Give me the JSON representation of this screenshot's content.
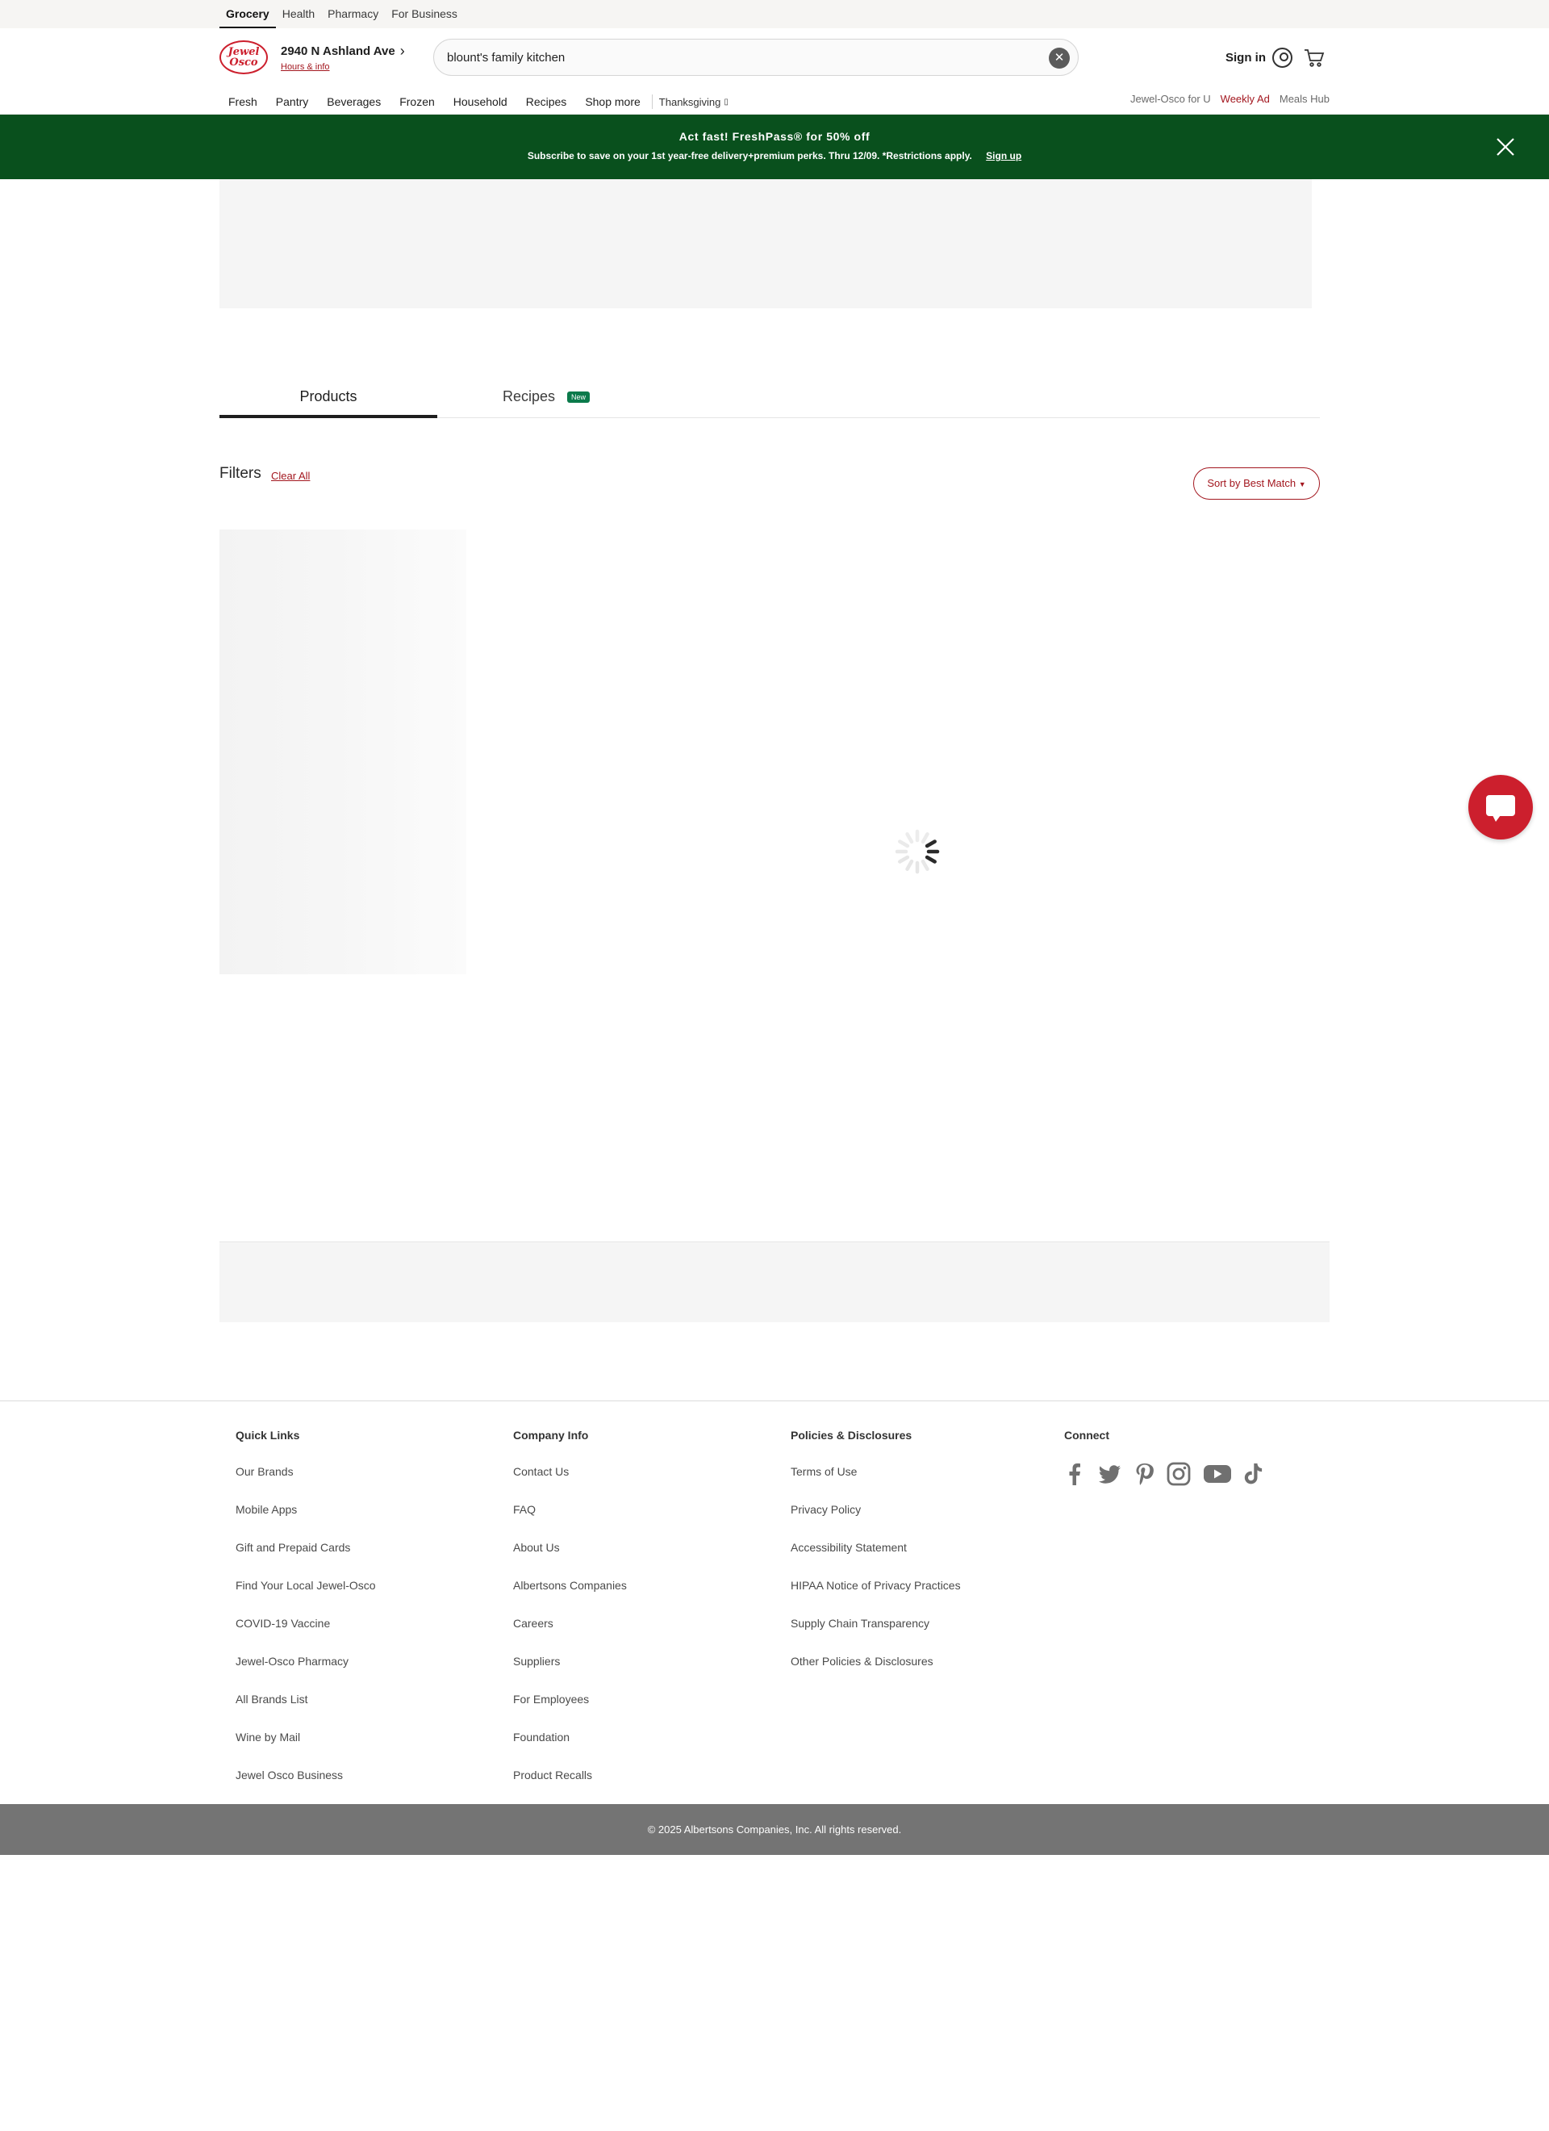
{
  "utility_tabs": [
    {
      "label": "Grocery",
      "active": true
    },
    {
      "label": "Health",
      "active": false
    },
    {
      "label": "Pharmacy",
      "active": false
    },
    {
      "label": "For Business",
      "active": false
    }
  ],
  "header": {
    "logo_text_1": "Jewel",
    "logo_text_2": "Osco",
    "store_address": "2940 N Ashland Ave",
    "hours_link": "Hours & info",
    "search_value": "blount's family kitchen",
    "signin_label": "Sign in"
  },
  "nav": {
    "items": [
      "Fresh",
      "Pantry",
      "Beverages",
      "Frozen",
      "Household",
      "Recipes",
      "Shop more"
    ],
    "seasonal": "Thanksgiving",
    "right_links": [
      "Jewel-Osco for U",
      "Weekly Ad",
      "Meals Hub"
    ]
  },
  "promo": {
    "title": "Act fast! FreshPass® for 50% off",
    "subtitle": "Subscribe to save on your 1st year-free delivery+premium perks. Thru 12/09. *Restrictions apply.",
    "signup_label": "Sign up"
  },
  "tabs": {
    "products": "Products",
    "recipes": "Recipes",
    "recipes_badge": "New"
  },
  "filters": {
    "title": "Filters",
    "clear_all": "Clear All",
    "sort_label": "Sort by Best Match"
  },
  "footer": {
    "quick_links": {
      "title": "Quick Links",
      "links": [
        "Our Brands",
        "Mobile Apps",
        "Gift and Prepaid Cards",
        "Find Your Local Jewel-Osco",
        "COVID-19 Vaccine",
        "Jewel-Osco Pharmacy",
        "All Brands List",
        "Wine by Mail",
        "Jewel Osco Business"
      ]
    },
    "company_info": {
      "title": "Company Info",
      "links": [
        "Contact Us",
        "FAQ",
        "About Us",
        "Albertsons Companies",
        "Careers",
        "Suppliers",
        "For Employees",
        "Foundation",
        "Product Recalls"
      ]
    },
    "policies": {
      "title": "Policies & Disclosures",
      "links": [
        "Terms of Use",
        "Privacy Policy",
        "Accessibility Statement",
        "HIPAA Notice of Privacy Practices",
        "Supply Chain Transparency",
        "Other Policies & Disclosures"
      ]
    },
    "connect": {
      "title": "Connect",
      "icons": [
        "facebook-icon",
        "twitter-icon",
        "pinterest-icon",
        "instagram-icon",
        "youtube-icon",
        "tiktok-icon"
      ]
    },
    "copyright": "© 2025 Albertsons Companies, Inc.  All rights reserved."
  },
  "colors": {
    "brand_red": "#cc1f2d",
    "link_red": "#a3171f",
    "promo_green": "#09501d",
    "badge_green": "#0b7a4b"
  }
}
